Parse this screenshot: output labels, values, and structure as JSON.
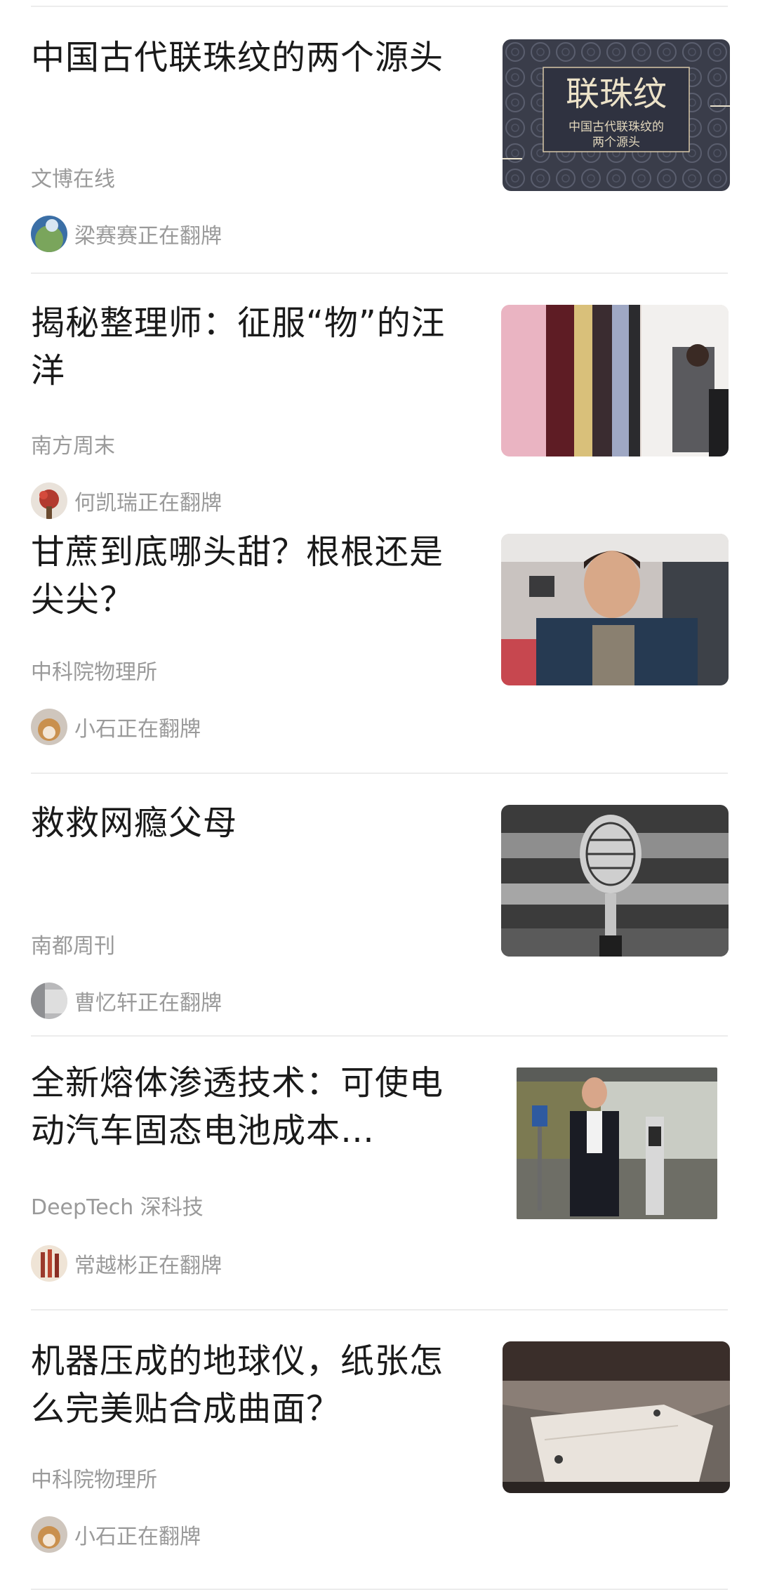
{
  "articles": [
    {
      "title": "中国古代联珠纹的两个源头",
      "source": "文博在线",
      "flipper": "梁赛赛正在翻牌",
      "thumb": {
        "heading": "联珠纹",
        "caption_line1": "中国古代联珠纹的",
        "caption_line2": "两个源头"
      }
    },
    {
      "title": "揭秘整理师：征服“物”的汪洋",
      "source": "南方周末",
      "flipper": "何凯瑞正在翻牌"
    },
    {
      "title": "甘蔗到底哪头甜？根根还是尖尖？",
      "source": "中科院物理所",
      "flipper": "小石正在翻牌"
    },
    {
      "title": "救救网瘾父母",
      "source": "南都周刊",
      "flipper": "曹忆轩正在翻牌"
    },
    {
      "title": "全新熔体渗透技术：可使电动汽车固态电池成本…",
      "source": "DeepTech 深科技",
      "flipper": "常越彬正在翻牌"
    },
    {
      "title": "机器压成的地球仪，纸张怎么完美贴合成曲面？",
      "source": "中科院物理所",
      "flipper": "小石正在翻牌"
    }
  ]
}
